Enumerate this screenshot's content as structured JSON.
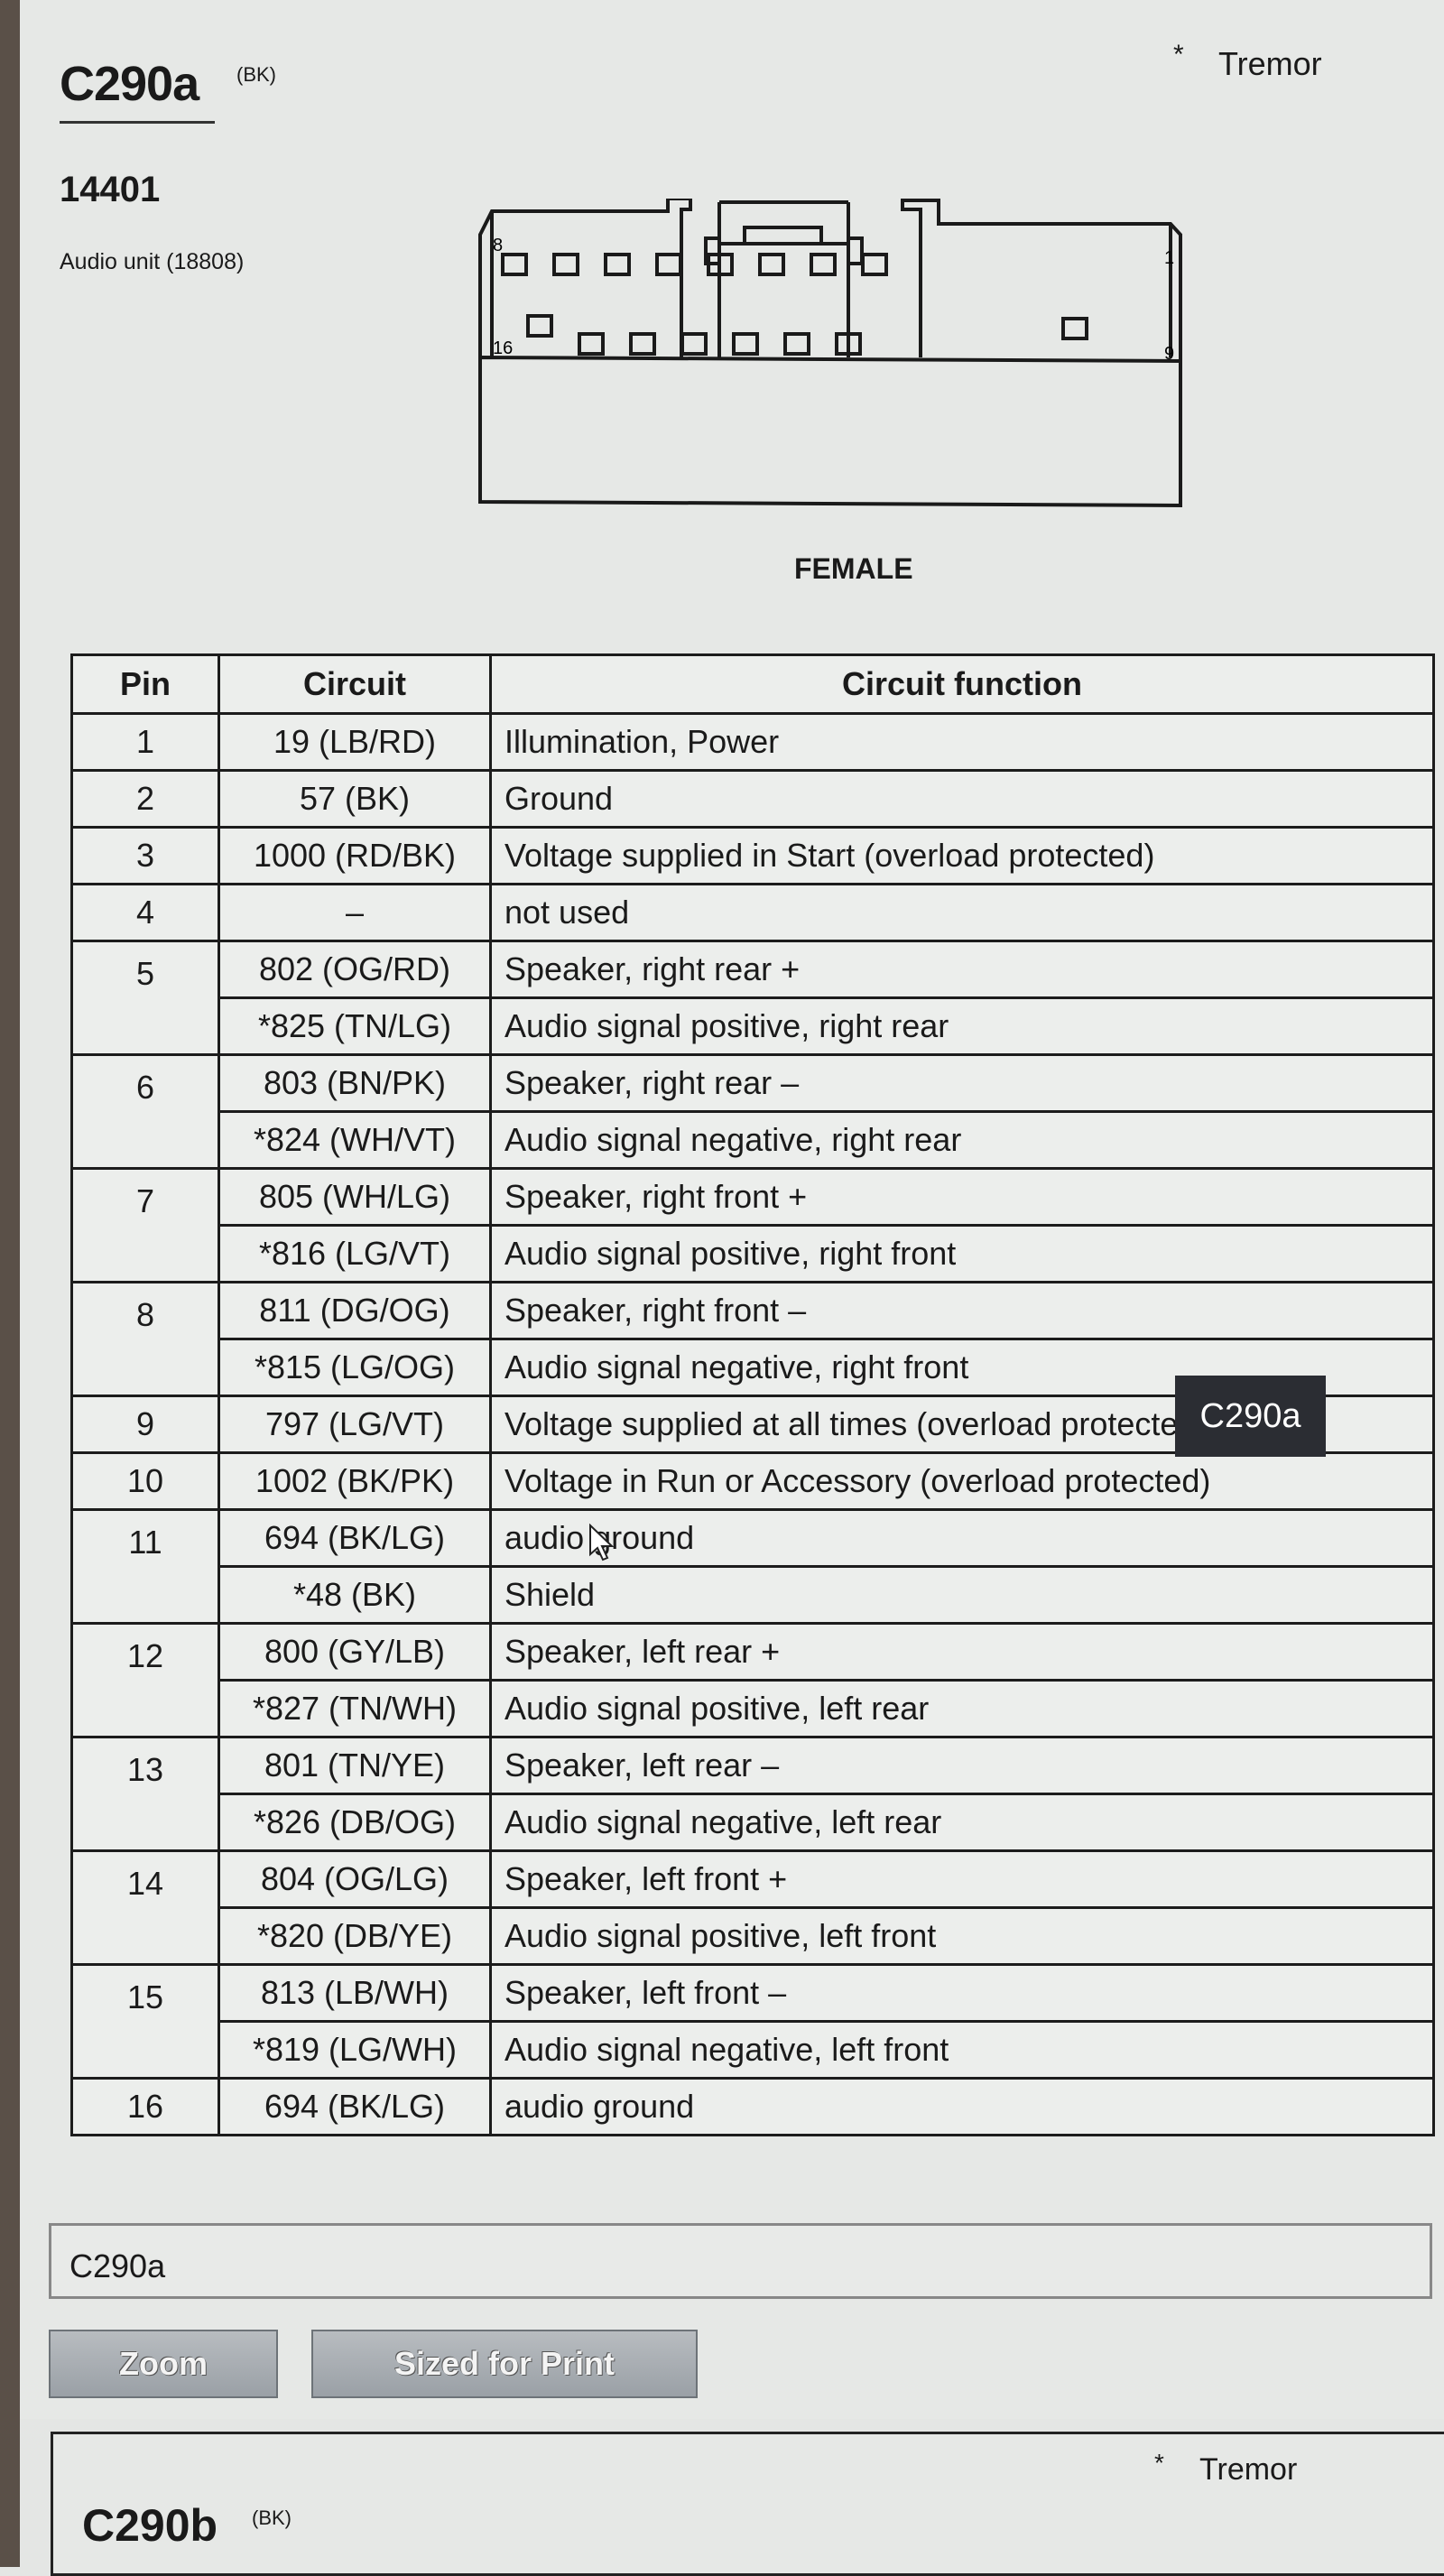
{
  "connector": {
    "id": "C290a",
    "color_code": "(BK)",
    "part_number": "14401",
    "description": "Audio unit (18808)",
    "note_marker": "*",
    "note": "Tremor",
    "view": "FEMALE",
    "pin_labels": {
      "top_left": "8",
      "top_right": "1",
      "bottom_left": "16",
      "bottom_right": "9"
    }
  },
  "table": {
    "headers": [
      "Pin",
      "Circuit",
      "Circuit function"
    ],
    "rows": [
      {
        "pin": "1",
        "circuit": "19 (LB/RD)",
        "function": "Illumination, Power",
        "span": 1
      },
      {
        "pin": "2",
        "circuit": "57 (BK)",
        "function": "Ground",
        "span": 1
      },
      {
        "pin": "3",
        "circuit": "1000 (RD/BK)",
        "function": "Voltage supplied in Start (overload protected)",
        "span": 1
      },
      {
        "pin": "4",
        "circuit": "–",
        "function": "not used",
        "span": 1
      },
      {
        "pin": "5",
        "circuit": "802 (OG/RD)",
        "function": "Speaker, right rear  +",
        "span": 2
      },
      {
        "pin": "",
        "circuit": "*825 (TN/LG)",
        "function": "Audio signal positive, right rear",
        "span": 0
      },
      {
        "pin": "6",
        "circuit": "803 (BN/PK)",
        "function": "Speaker, right rear  –",
        "span": 2
      },
      {
        "pin": "",
        "circuit": "*824 (WH/VT)",
        "function": "Audio signal negative, right rear",
        "span": 0
      },
      {
        "pin": "7",
        "circuit": "805 (WH/LG)",
        "function": "Speaker, right front  +",
        "span": 2
      },
      {
        "pin": "",
        "circuit": "*816 (LG/VT)",
        "function": "Audio signal positive, right front",
        "span": 0
      },
      {
        "pin": "8",
        "circuit": "811 (DG/OG)",
        "function": "Speaker, right front  –",
        "span": 2
      },
      {
        "pin": "",
        "circuit": "*815 (LG/OG)",
        "function": "Audio signal negative, right front",
        "span": 0
      },
      {
        "pin": "9",
        "circuit": "797 (LG/VT)",
        "function": "Voltage supplied at all times (overload protected)",
        "span": 1
      },
      {
        "pin": "10",
        "circuit": "1002 (BK/PK)",
        "function": "Voltage in Run or Accessory (overload protected)",
        "span": 1
      },
      {
        "pin": "11",
        "circuit": "694 (BK/LG)",
        "function": "audio ground",
        "span": 2
      },
      {
        "pin": "",
        "circuit": "*48 (BK)",
        "function": "Shield",
        "span": 0
      },
      {
        "pin": "12",
        "circuit": "800 (GY/LB)",
        "function": "Speaker, left rear  +",
        "span": 2
      },
      {
        "pin": "",
        "circuit": "*827 (TN/WH)",
        "function": "Audio signal positive, left rear",
        "span": 0
      },
      {
        "pin": "13",
        "circuit": "801 (TN/YE)",
        "function": "Speaker, left rear  –",
        "span": 2
      },
      {
        "pin": "",
        "circuit": "*826 (DB/OG)",
        "function": "Audio signal negative, left rear",
        "span": 0
      },
      {
        "pin": "14",
        "circuit": "804 (OG/LG)",
        "function": "Speaker, left front  +",
        "span": 2
      },
      {
        "pin": "",
        "circuit": "*820 (DB/YE)",
        "function": "Audio signal positive, left front",
        "span": 0
      },
      {
        "pin": "15",
        "circuit": "813 (LB/WH)",
        "function": "Speaker, left front  –",
        "span": 2
      },
      {
        "pin": "",
        "circuit": "*819 (LG/WH)",
        "function": "Audio signal negative, left front",
        "span": 0
      },
      {
        "pin": "16",
        "circuit": "694 (BK/LG)",
        "function": "audio ground",
        "span": 1
      }
    ]
  },
  "caption": "C290a",
  "tooltip": "C290a",
  "buttons": {
    "zoom": "Zoom",
    "sized_for_print": "Sized for Print"
  },
  "next_connector": {
    "id": "C290b",
    "color_code": "(BK)",
    "note_marker": "*",
    "note": "Tremor"
  }
}
